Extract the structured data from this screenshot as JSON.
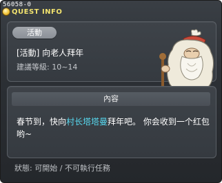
{
  "window": {
    "quest_id": "56058-0",
    "title": "QUEST INFO"
  },
  "quest": {
    "category_badge": "活動",
    "name": "[活動] 向老人拜年",
    "level_requirement": "建議等級: 10~14",
    "npc_name": "村长塔塔曼"
  },
  "content": {
    "section_title": "內容",
    "description_before": "春节到，快向",
    "description_link": "村长塔塔曼",
    "description_after": "拜年吧。 你会收到一个红包哟~"
  },
  "status_text": "狀態: 可開始 / 不可執行任務",
  "colors": {
    "title_text": "#f2e36e",
    "npc_link": "#57d8ef",
    "window_bg": "#2c3035"
  },
  "icons": {
    "title": "quest-info-icon",
    "npc": "village-chief-tatamo-sprite"
  }
}
